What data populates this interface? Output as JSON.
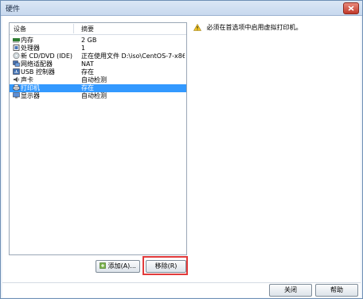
{
  "window": {
    "title": "硬件"
  },
  "devices": {
    "columns": {
      "device": "设备",
      "summary": "摘要"
    },
    "rows": [
      {
        "icon": "memory-icon",
        "name": "内存",
        "summary": "2 GB"
      },
      {
        "icon": "processor-icon",
        "name": "处理器",
        "summary": "1"
      },
      {
        "icon": "cd-dvd-icon",
        "name": "新 CD/DVD (IDE)",
        "summary": "正在使用文件 D:\\iso\\CentOS-7-x86..."
      },
      {
        "icon": "network-adapter-icon",
        "name": "网络适配器",
        "summary": "NAT"
      },
      {
        "icon": "usb-controller-icon",
        "name": "USB 控制器",
        "summary": "存在"
      },
      {
        "icon": "sound-card-icon",
        "name": "声卡",
        "summary": "自动检测"
      },
      {
        "icon": "printer-icon",
        "name": "打印机",
        "summary": "存在",
        "selected": true
      },
      {
        "icon": "display-icon",
        "name": "显示器",
        "summary": "自动检测"
      }
    ]
  },
  "buttons": {
    "add": "添加(A)...",
    "remove": "移除(R)",
    "close": "关闭",
    "help": "帮助"
  },
  "message": {
    "text": "必须在首选项中启用虚拟打印机。",
    "icon": "warning-icon"
  },
  "colors": {
    "selection": "#3399ff",
    "highlight_box": "#e23b3b",
    "warning": "#f3c623"
  }
}
